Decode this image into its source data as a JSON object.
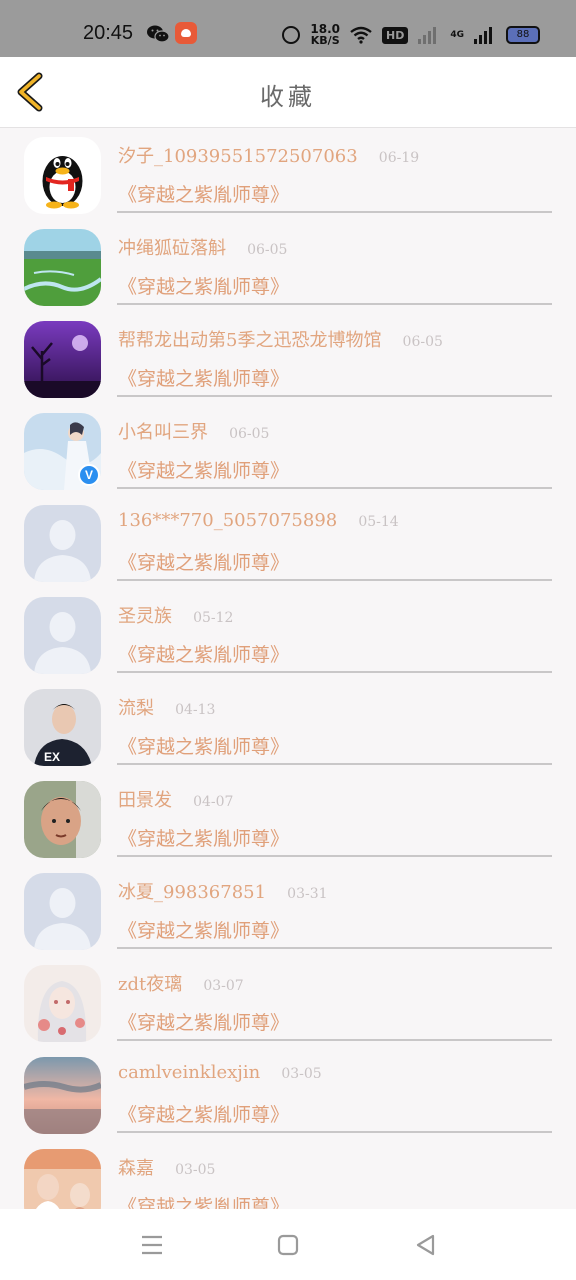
{
  "status_bar": {
    "time": "20:45",
    "net_speed_value": "18.0",
    "net_speed_unit": "KB/S",
    "hd_label": "HD",
    "network_type": "4G",
    "battery": "88",
    "icons": [
      "wechat-icon",
      "app-notification-icon",
      "alarm-icon",
      "wifi-icon",
      "signal-icon",
      "battery-icon"
    ]
  },
  "header": {
    "title": "收藏",
    "back_icon": "chevron-left-icon",
    "accent_color": "#f0b429"
  },
  "colors": {
    "name": "#e1a57f",
    "book": "#e0a07a",
    "date": "#c9c3c4",
    "divider": "#c9c7c8"
  },
  "items": [
    {
      "name": "汐子_10939551572507063",
      "date": "06-19",
      "book": "《穿越之紫胤师尊》",
      "avatar": "qq-penguin",
      "verified": false
    },
    {
      "name": "冲绳狐砬落斛",
      "date": "06-05",
      "book": "《穿越之紫胤师尊》",
      "avatar": "landscape-green",
      "verified": false
    },
    {
      "name": "帮帮龙出动第5季之迅恐龙博物馆",
      "date": "06-05",
      "book": "《穿越之紫胤师尊》",
      "avatar": "purple-night",
      "verified": false
    },
    {
      "name": "小名叫三界",
      "date": "06-05",
      "book": "《穿越之紫胤师尊》",
      "avatar": "fantasy-character",
      "verified": true
    },
    {
      "name": "136***770_5057075898",
      "date": "05-14",
      "book": "《穿越之紫胤师尊》",
      "avatar": "default-person",
      "verified": false
    },
    {
      "name": "圣灵族",
      "date": "05-12",
      "book": "《穿越之紫胤师尊》",
      "avatar": "default-person",
      "verified": false
    },
    {
      "name": "流梨",
      "date": "04-13",
      "book": "《穿越之紫胤师尊》",
      "avatar": "young-man",
      "verified": false
    },
    {
      "name": "田景发",
      "date": "04-07",
      "book": "《穿越之紫胤师尊》",
      "avatar": "selfie-face",
      "verified": false
    },
    {
      "name": "冰夏_998367851",
      "date": "03-31",
      "book": "《穿越之紫胤师尊》",
      "avatar": "default-person",
      "verified": false
    },
    {
      "name": "zdt夜璃",
      "date": "03-07",
      "book": "《穿越之紫胤师尊》",
      "avatar": "anime-girl",
      "verified": false
    },
    {
      "name": "camlveinklexjin",
      "date": "03-05",
      "book": "《穿越之紫胤师尊》",
      "avatar": "sunset-sea",
      "verified": false
    },
    {
      "name": "森嘉",
      "date": "03-05",
      "book": "《穿越之紫胤师尊》",
      "avatar": "couple-photo",
      "verified": false
    }
  ],
  "nav_bar": {
    "icons": [
      "menu-icon",
      "home-icon",
      "back-triangle-icon"
    ]
  }
}
